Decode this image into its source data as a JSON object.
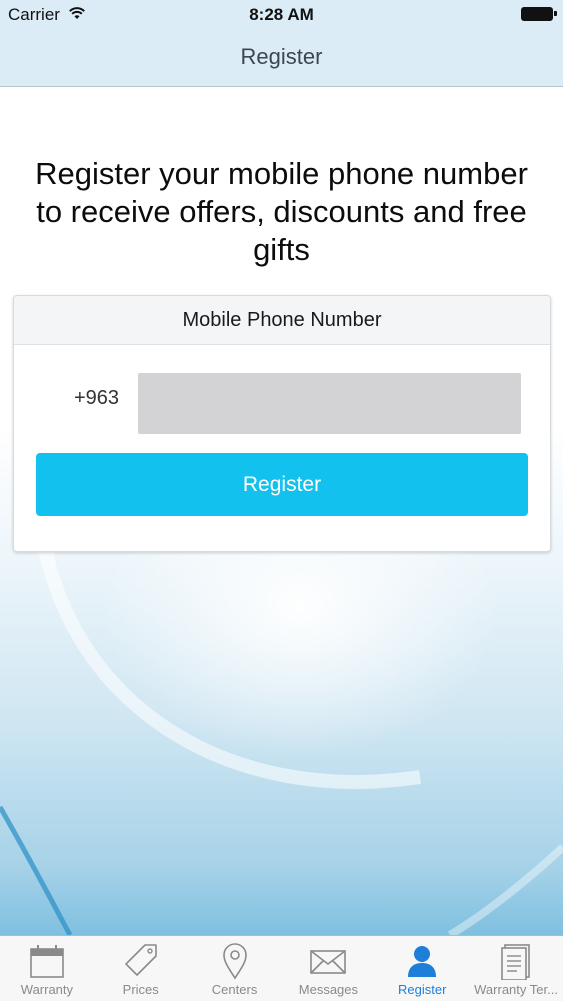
{
  "status_bar": {
    "carrier": "Carrier",
    "time": "8:28 AM"
  },
  "nav": {
    "title": "Register"
  },
  "headline": "Register your mobile phone number to receive offers, discounts and free gifts",
  "form": {
    "card_title": "Mobile Phone Number",
    "country_code": "+963",
    "phone_value": "",
    "submit_label": "Register"
  },
  "tabs": [
    {
      "label": "Warranty",
      "icon": "calendar-icon",
      "active": false
    },
    {
      "label": "Prices",
      "icon": "price-tag-icon",
      "active": false
    },
    {
      "label": "Centers",
      "icon": "location-pin-icon",
      "active": false
    },
    {
      "label": "Messages",
      "icon": "envelope-icon",
      "active": false
    },
    {
      "label": "Register",
      "icon": "user-icon",
      "active": true
    },
    {
      "label": "Warranty Ter...",
      "icon": "document-icon",
      "active": false
    }
  ],
  "colors": {
    "accent": "#13c1ef",
    "active_tab": "#1e7fdb",
    "nav_background": "#dcecf7"
  }
}
